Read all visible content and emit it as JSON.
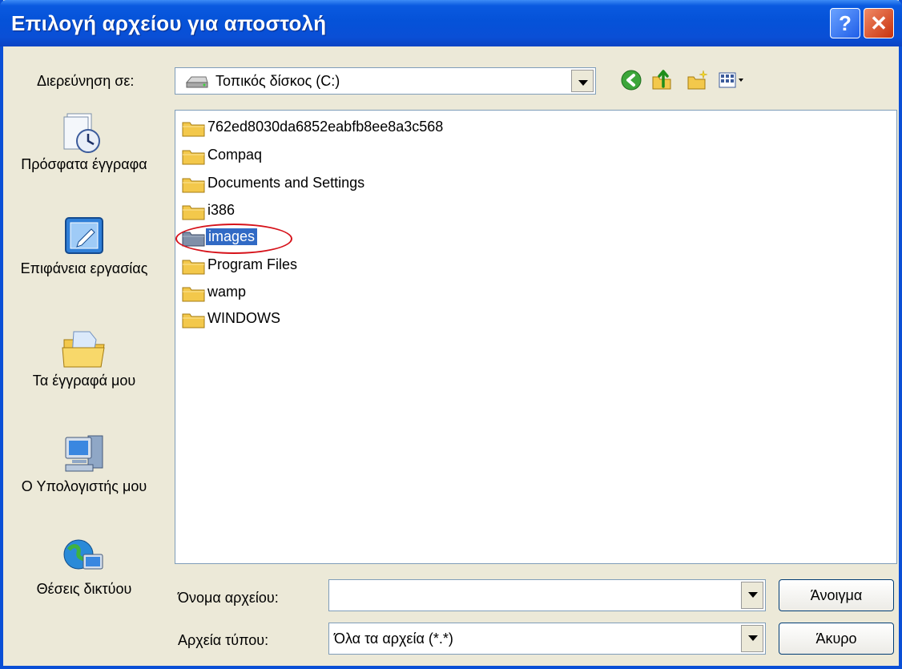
{
  "window": {
    "title": "Επιλογή αρχείου για αποστολή",
    "help_label": "?",
    "close_label": "✕"
  },
  "lookin": {
    "label": "Διερεύνηση σε:",
    "value": "Τοπικός δίσκος (C:)"
  },
  "toolbar": {
    "icons": [
      "back-icon",
      "up-folder-icon",
      "new-folder-icon",
      "view-menu-icon"
    ]
  },
  "places": [
    {
      "label": "Πρόσφατα έγγραφα",
      "icon": "recent-documents-icon"
    },
    {
      "label": "Επιφάνεια εργασίας",
      "icon": "desktop-icon"
    },
    {
      "label": "Τα έγγραφά μου",
      "icon": "my-documents-icon"
    },
    {
      "label": "Ο Υπολογιστής μου",
      "icon": "my-computer-icon"
    },
    {
      "label": "Θέσεις δικτύου",
      "icon": "network-places-icon"
    }
  ],
  "files": [
    {
      "name": "762ed8030da6852eabfb8ee8a3c568",
      "selected": false
    },
    {
      "name": "Compaq",
      "selected": false
    },
    {
      "name": "Documents and Settings",
      "selected": false
    },
    {
      "name": "i386",
      "selected": false
    },
    {
      "name": "images",
      "selected": true
    },
    {
      "name": "Program Files",
      "selected": false
    },
    {
      "name": "wamp",
      "selected": false
    },
    {
      "name": "WINDOWS",
      "selected": false
    }
  ],
  "filename": {
    "label": "Όνομα αρχείου:",
    "value": ""
  },
  "filetype": {
    "label": "Αρχεία τύπου:",
    "value": "Όλα τα αρχεία (*.*)"
  },
  "buttons": {
    "open": "Άνοιγμα",
    "cancel": "Άκυρο"
  },
  "colors": {
    "titlebar": "#0a4fd6",
    "selection": "#316ac5",
    "annotation": "#d6121a",
    "background": "#ece9d8"
  }
}
